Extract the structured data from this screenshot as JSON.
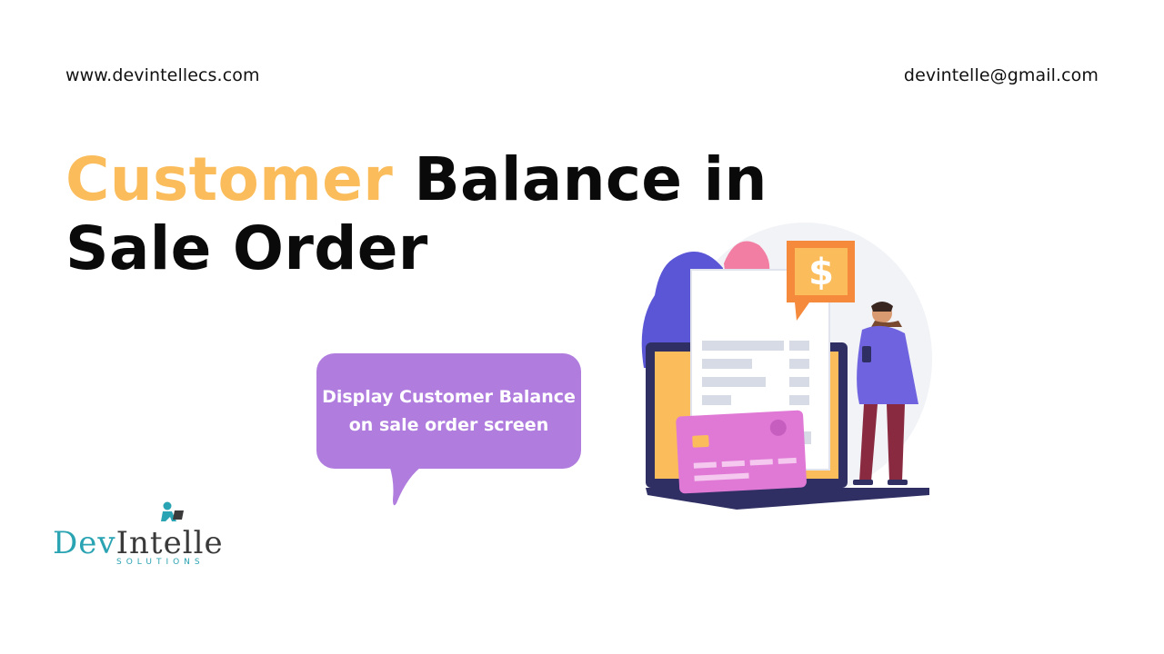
{
  "header": {
    "website": "www.devintellecs.com",
    "email": "devintelle@gmail.com"
  },
  "title": {
    "accent": "Customer",
    "rest": "Balance in Sale Order"
  },
  "bubble": {
    "line1": "Display Customer Balance",
    "line2": "on sale order screen"
  },
  "logo": {
    "dev": "Dev",
    "intelle": "Intelle",
    "sub": "SOLUTIONS"
  },
  "illustration": {
    "currency_symbol": "$"
  },
  "colors": {
    "accent": "#fbbd5c",
    "bubble": "#b07ddf",
    "logo_teal": "#2aa3b2"
  }
}
